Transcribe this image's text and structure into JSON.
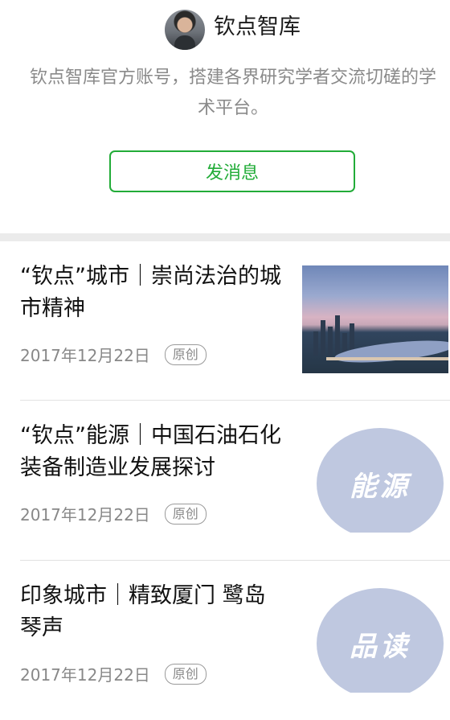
{
  "account": {
    "name": "钦点智库",
    "description": "钦点智库官方账号，搭建各界研究学者交流切磋的学术平台。",
    "message_button": "发消息"
  },
  "articles": [
    {
      "title": "“钦点”城市｜崇尚法治的城市精神",
      "date": "2017年12月22日",
      "badge": "原创",
      "thumb_text": ""
    },
    {
      "title": "“钦点”能源｜中国石油石化装备制造业发展探讨",
      "date": "2017年12月22日",
      "badge": "原创",
      "thumb_text": "能源"
    },
    {
      "title": "印象城市｜精致厦门 鹭岛琴声",
      "date": "2017年12月22日",
      "badge": "原创",
      "thumb_text": "品读"
    }
  ],
  "colors": {
    "accent_green": "#22ac38",
    "thumb_circle": "#bfc8e0"
  }
}
